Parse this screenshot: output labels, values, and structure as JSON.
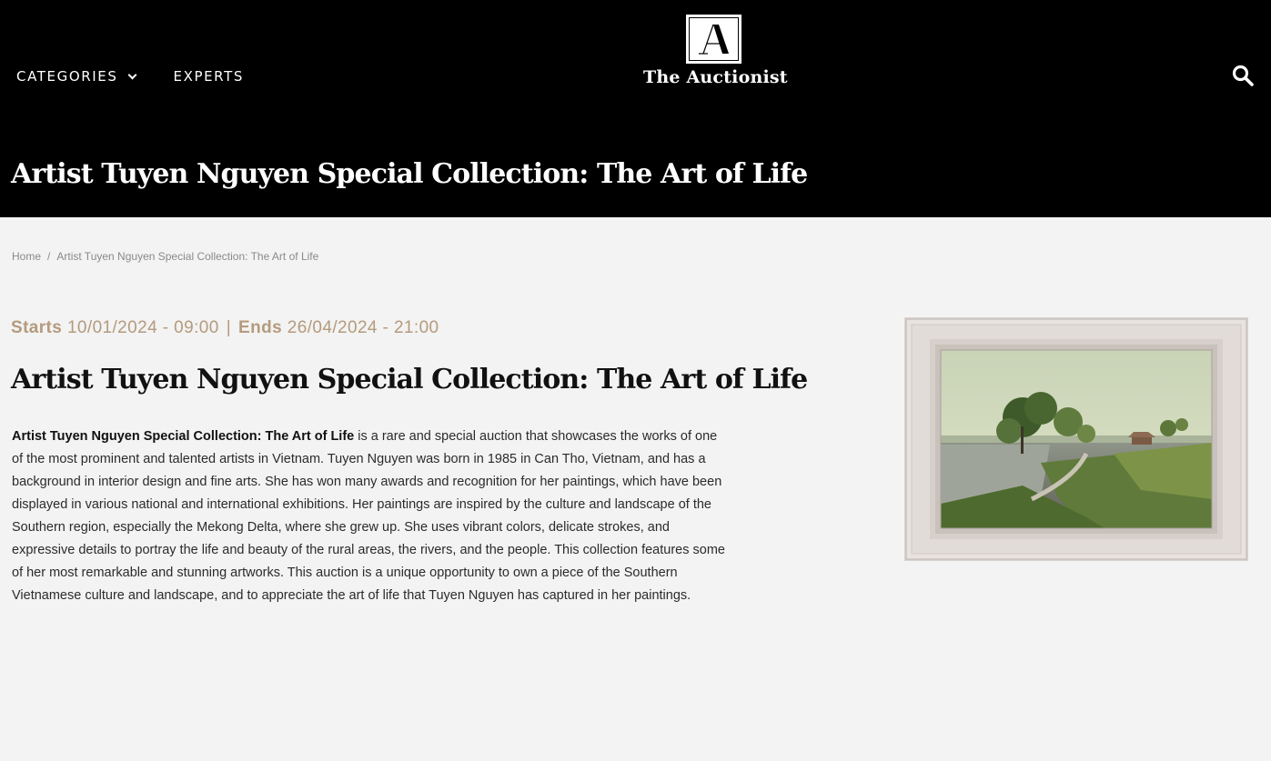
{
  "header": {
    "nav": [
      {
        "label": "CATEGORIES",
        "has_dropdown": true
      },
      {
        "label": "EXPERTS",
        "has_dropdown": false
      }
    ],
    "logo_letter": "A",
    "logo_text": "The Auctionist",
    "search_icon": "search-icon",
    "background": "#000000"
  },
  "page": {
    "title": "Artist Tuyen Nguyen Special Collection: The Art of Life"
  },
  "breadcrumb": {
    "home": "Home",
    "separator": "/",
    "current": "Artist Tuyen Nguyen Special Collection: The Art of Life"
  },
  "auction": {
    "starts_label": "Starts",
    "starts_value": "10/01/2024 - 09:00",
    "pipe": "|",
    "ends_label": "Ends",
    "ends_value": "26/04/2024 - 21:00",
    "title": "Artist Tuyen Nguyen Special Collection: The Art of Life",
    "description_bold": "Artist Tuyen Nguyen Special Collection: The Art of Life",
    "description_rest": " is a rare and special auction that showcases the works of one of the most prominent and talented artists in Vietnam. Tuyen Nguyen was born in 1985 in Can Tho, Vietnam, and has a background in interior design and fine arts. She has won many awards and recognition for her paintings, which have been displayed in various national and international exhibitions. Her paintings are inspired by the culture and landscape of the Southern region, especially the Mekong Delta, where she grew up. She uses vibrant colors, delicate strokes, and expressive details to portray the life and beauty of the rural areas, the rivers, and the people. This collection features some of her most remarkable and stunning artworks. This auction is a unique opportunity to own a piece of the Southern Vietnamese culture and landscape, and to appreciate the art of life that Tuyen Nguyen has captured in her paintings.",
    "accent_color": "#b59a7e"
  }
}
